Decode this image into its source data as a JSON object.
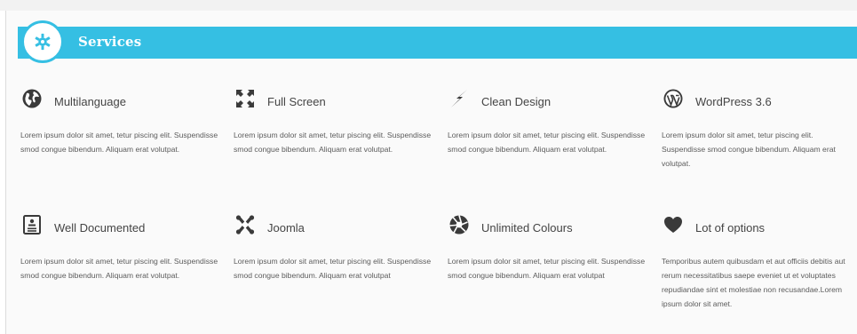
{
  "section": {
    "title": "Services",
    "badge_icon": "gear-icon",
    "accent": "#35bfe3"
  },
  "features": [
    {
      "title": "Multilanguage",
      "icon": "globe-icon",
      "text": "Lorem ipsum dolor sit amet, tetur piscing elit. Suspendisse smod congue bibendum. Aliquam erat volutpat."
    },
    {
      "title": "Full Screen",
      "icon": "fullscreen-icon",
      "text": "Lorem ipsum dolor sit amet, tetur piscing elit. Suspendisse smod congue bibendum. Aliquam erat volutpat."
    },
    {
      "title": "Clean Design",
      "icon": "lightning-icon",
      "text": "Lorem ipsum dolor sit amet, tetur piscing elit. Suspendisse smod congue bibendum. Aliquam erat volutpat."
    },
    {
      "title": "WordPress 3.6",
      "icon": "wordpress-icon",
      "text": "Lorem ipsum dolor sit amet, tetur piscing elit. Suspendisse smod congue bibendum. Aliquam erat volutpat."
    },
    {
      "title": "Well Documented",
      "icon": "document-icon",
      "text": "Lorem ipsum dolor sit amet, tetur piscing elit. Suspendisse smod congue bibendum. Aliquam erat volutpat."
    },
    {
      "title": "Joomla",
      "icon": "joomla-icon",
      "text": "Lorem ipsum dolor sit amet, tetur piscing elit. Suspendisse smod congue bibendum. Aliquam erat volutpat"
    },
    {
      "title": "Unlimited Colours",
      "icon": "aperture-icon",
      "text": "Lorem ipsum dolor sit amet, tetur piscing elit. Suspendisse smod congue bibendum. Aliquam erat volutpat"
    },
    {
      "title": "Lot of options",
      "icon": "heart-icon",
      "text": "Temporibus autem quibusdam et aut officiis debitis aut rerum necessitatibus saepe eveniet ut et voluptates repudiandae sint et molestiae non recusandae.Lorem ipsum dolor sit amet."
    }
  ]
}
